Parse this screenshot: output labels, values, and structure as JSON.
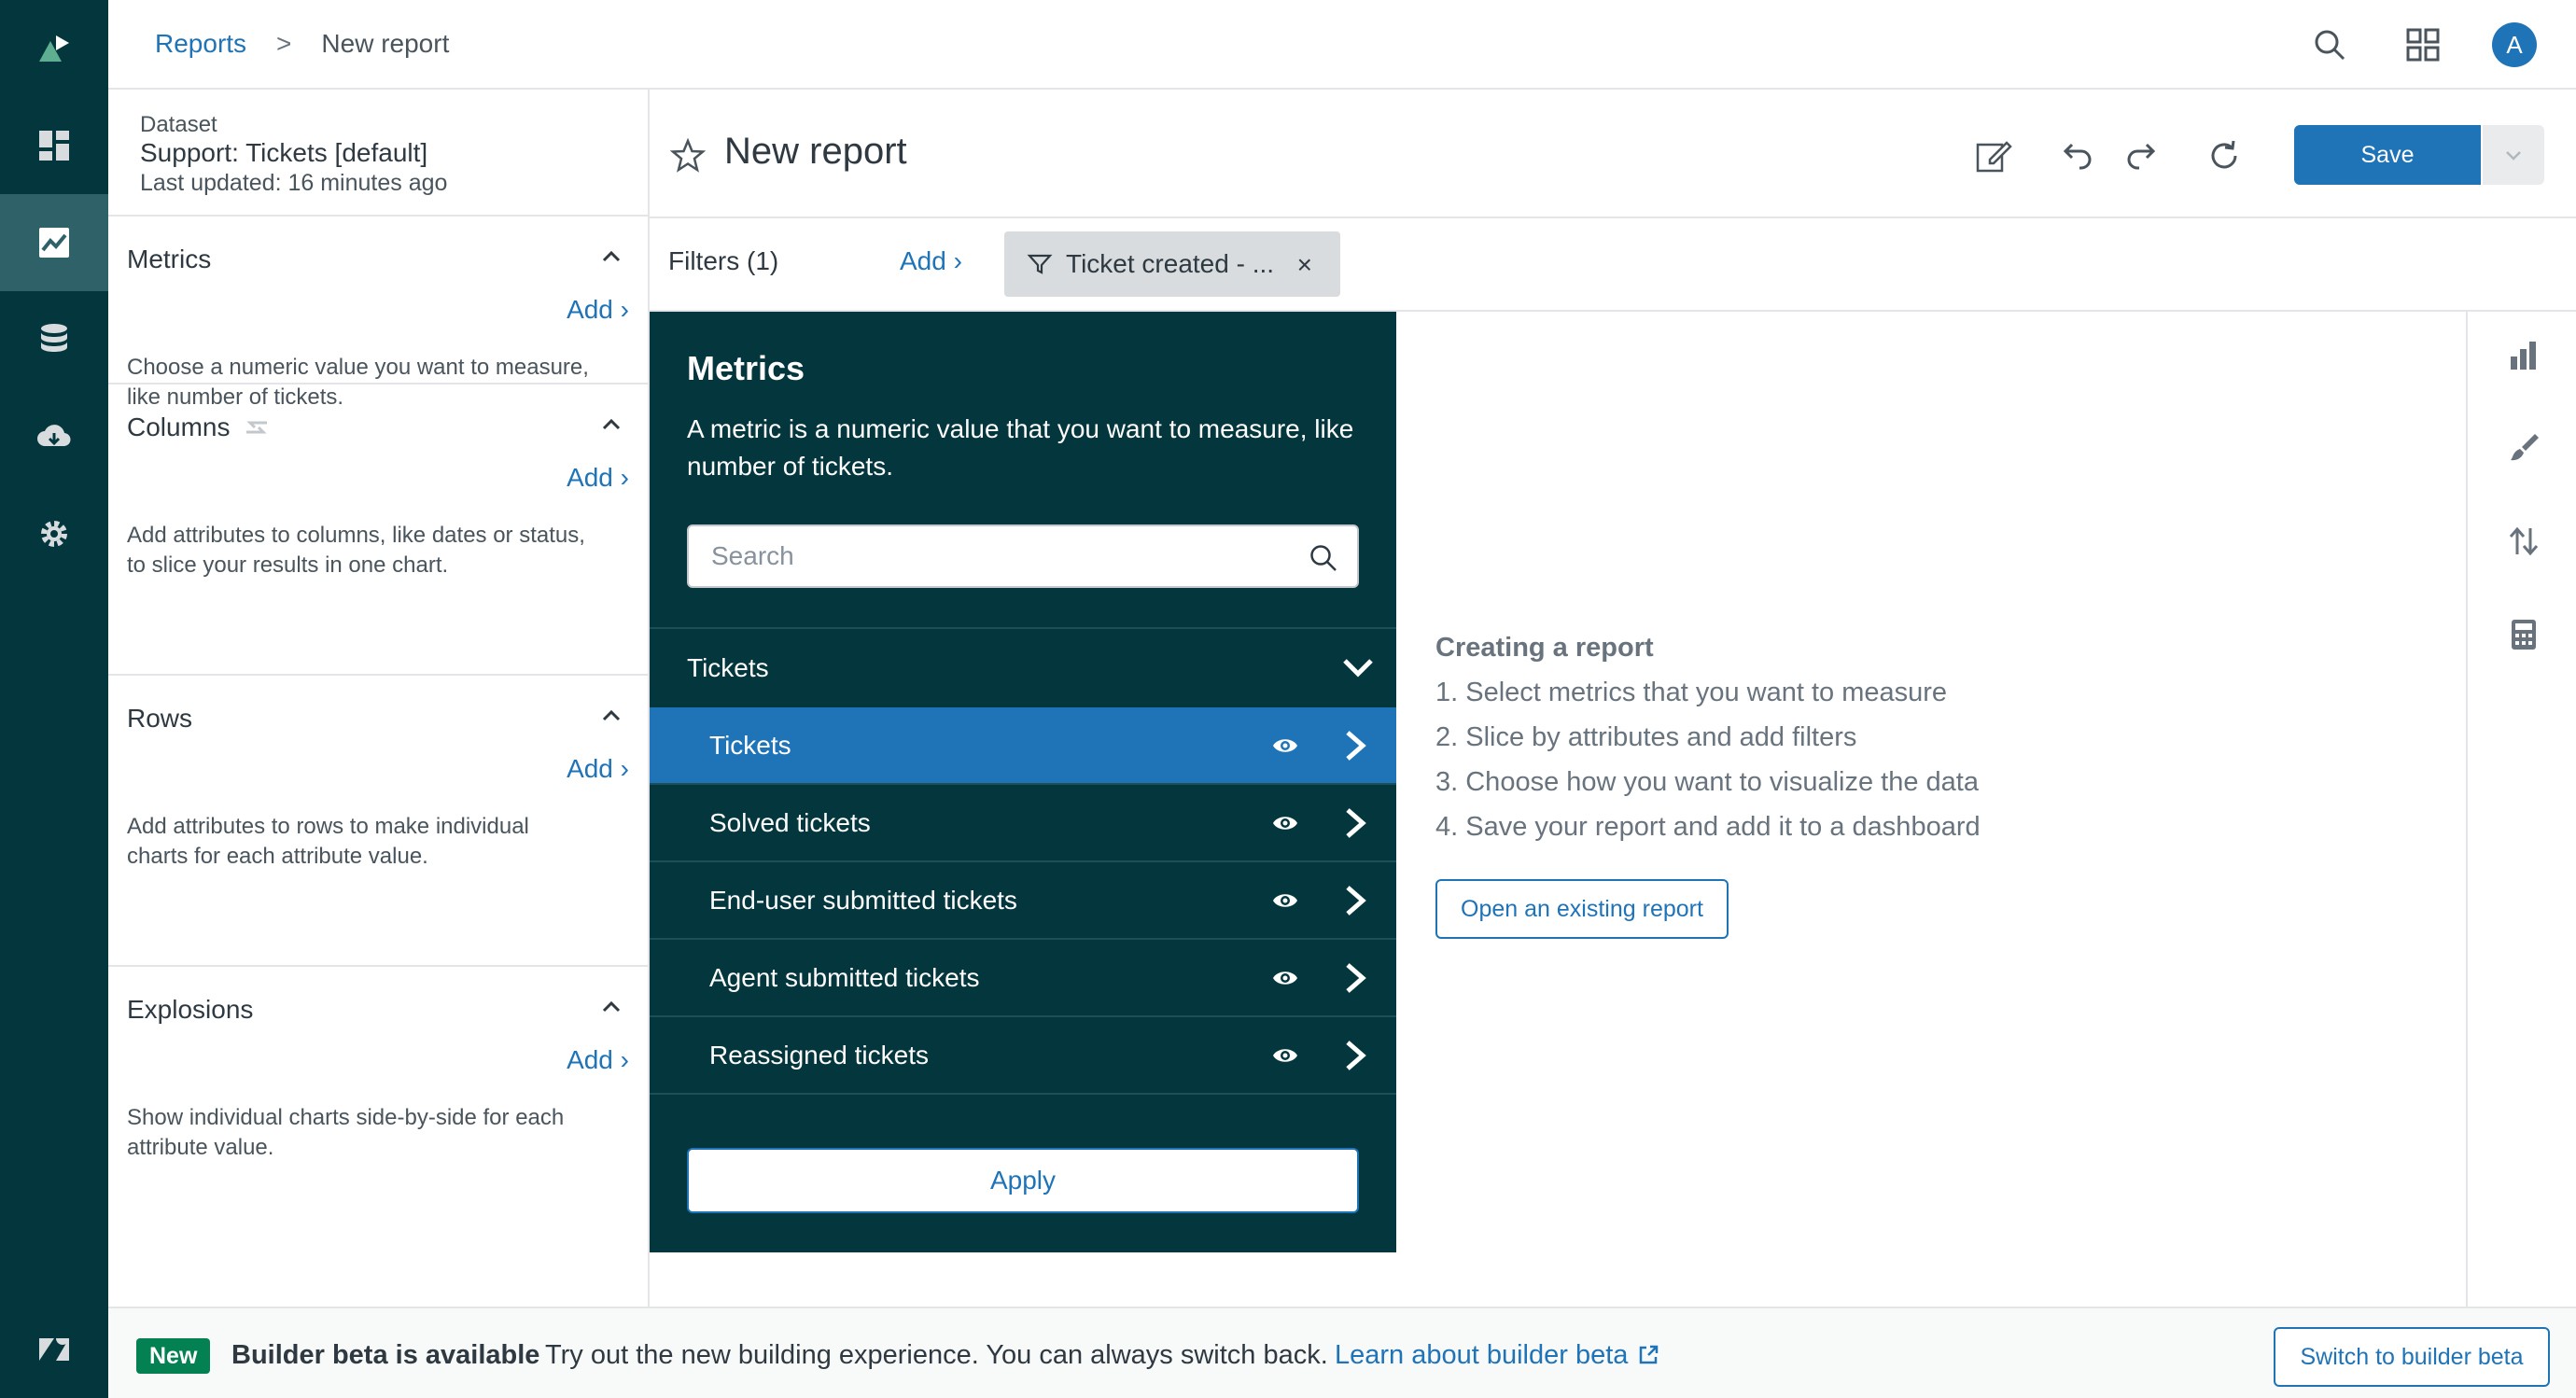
{
  "breadcrumb": {
    "parent": "Reports",
    "separator": ">",
    "current": "New report"
  },
  "user": {
    "initial": "A"
  },
  "rail": {
    "items": [
      "logo-icon",
      "dashboard-icon",
      "reports-icon",
      "datasets-icon",
      "download-icon",
      "settings-icon",
      "zendesk-logo-icon"
    ]
  },
  "dataset": {
    "label": "Dataset",
    "name": "Support: Tickets [default]",
    "updated": "Last updated: 16 minutes ago"
  },
  "config": {
    "add_label": "Add",
    "metrics": {
      "title": "Metrics",
      "desc": "Choose a numeric value you want to measure, like number of tickets."
    },
    "columns": {
      "title": "Columns",
      "desc": "Add attributes to columns, like dates or status, to slice your results in one chart."
    },
    "rows": {
      "title": "Rows",
      "desc": "Add attributes to rows to make individual charts for each attribute value."
    },
    "explosions": {
      "title": "Explosions",
      "desc": "Show individual charts side-by-side for each attribute value."
    }
  },
  "report": {
    "title": "New report",
    "save_label": "Save"
  },
  "filters": {
    "label": "Filters (1)",
    "add_label": "Add",
    "chip_label": "Ticket created - ...",
    "chip_close": "×"
  },
  "metrics_panel": {
    "title": "Metrics",
    "desc": "A metric is a numeric value that you want to measure, like number of tickets.",
    "search_placeholder": "Search",
    "group": "Tickets",
    "items": [
      {
        "label": "Tickets",
        "selected": true
      },
      {
        "label": "Solved tickets",
        "selected": false
      },
      {
        "label": "End-user submitted tickets",
        "selected": false
      },
      {
        "label": "Agent submitted tickets",
        "selected": false
      },
      {
        "label": "Reassigned tickets",
        "selected": false
      }
    ],
    "apply_label": "Apply"
  },
  "help": {
    "title": "Creating a report",
    "steps": [
      "1. Select metrics that you want to measure",
      "2. Slice by attributes and add filters",
      "3. Choose how you want to visualize the data",
      "4. Save your report and add it to a dashboard"
    ],
    "open_label": "Open an existing report"
  },
  "banner": {
    "badge": "New",
    "bold": "Builder beta is available",
    "text": "Try out the new building experience. You can always switch back.",
    "link": "Learn about builder beta",
    "button": "Switch to builder beta"
  },
  "colors": {
    "rail_bg": "#03363d",
    "accent": "#1f73b7",
    "badge_green": "#038153"
  }
}
